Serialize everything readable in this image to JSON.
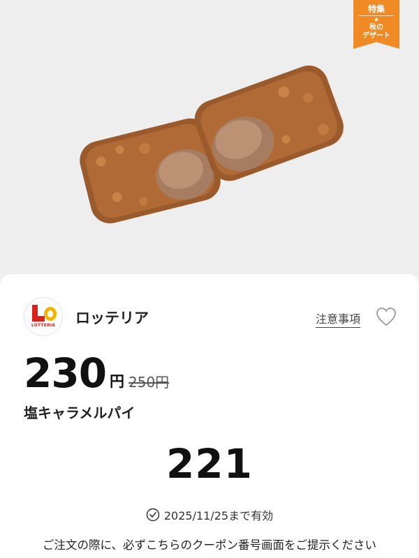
{
  "badge": {
    "top": "特集",
    "star": "★",
    "bottom_line1": "秋の",
    "bottom_line2": "デザート"
  },
  "brand": {
    "name": "ロッテリア",
    "logo_text": "LOTTERIA"
  },
  "links": {
    "notes": "注意事項"
  },
  "icons": {
    "favorite": "heart-icon",
    "clock": "clock-icon"
  },
  "price": {
    "current": "230",
    "unit": "円",
    "original": "250円"
  },
  "product": {
    "name": "塩キャラメルパイ"
  },
  "coupon": {
    "code": "221",
    "validity": "2025/11/25まで有効"
  },
  "notice": "ご注文の際に、必ずこちらのクーポン番号画面をご提示ください",
  "colors": {
    "accent": "#f08a24",
    "brand_red": "#d9231c",
    "brand_yellow": "#f4b400"
  }
}
